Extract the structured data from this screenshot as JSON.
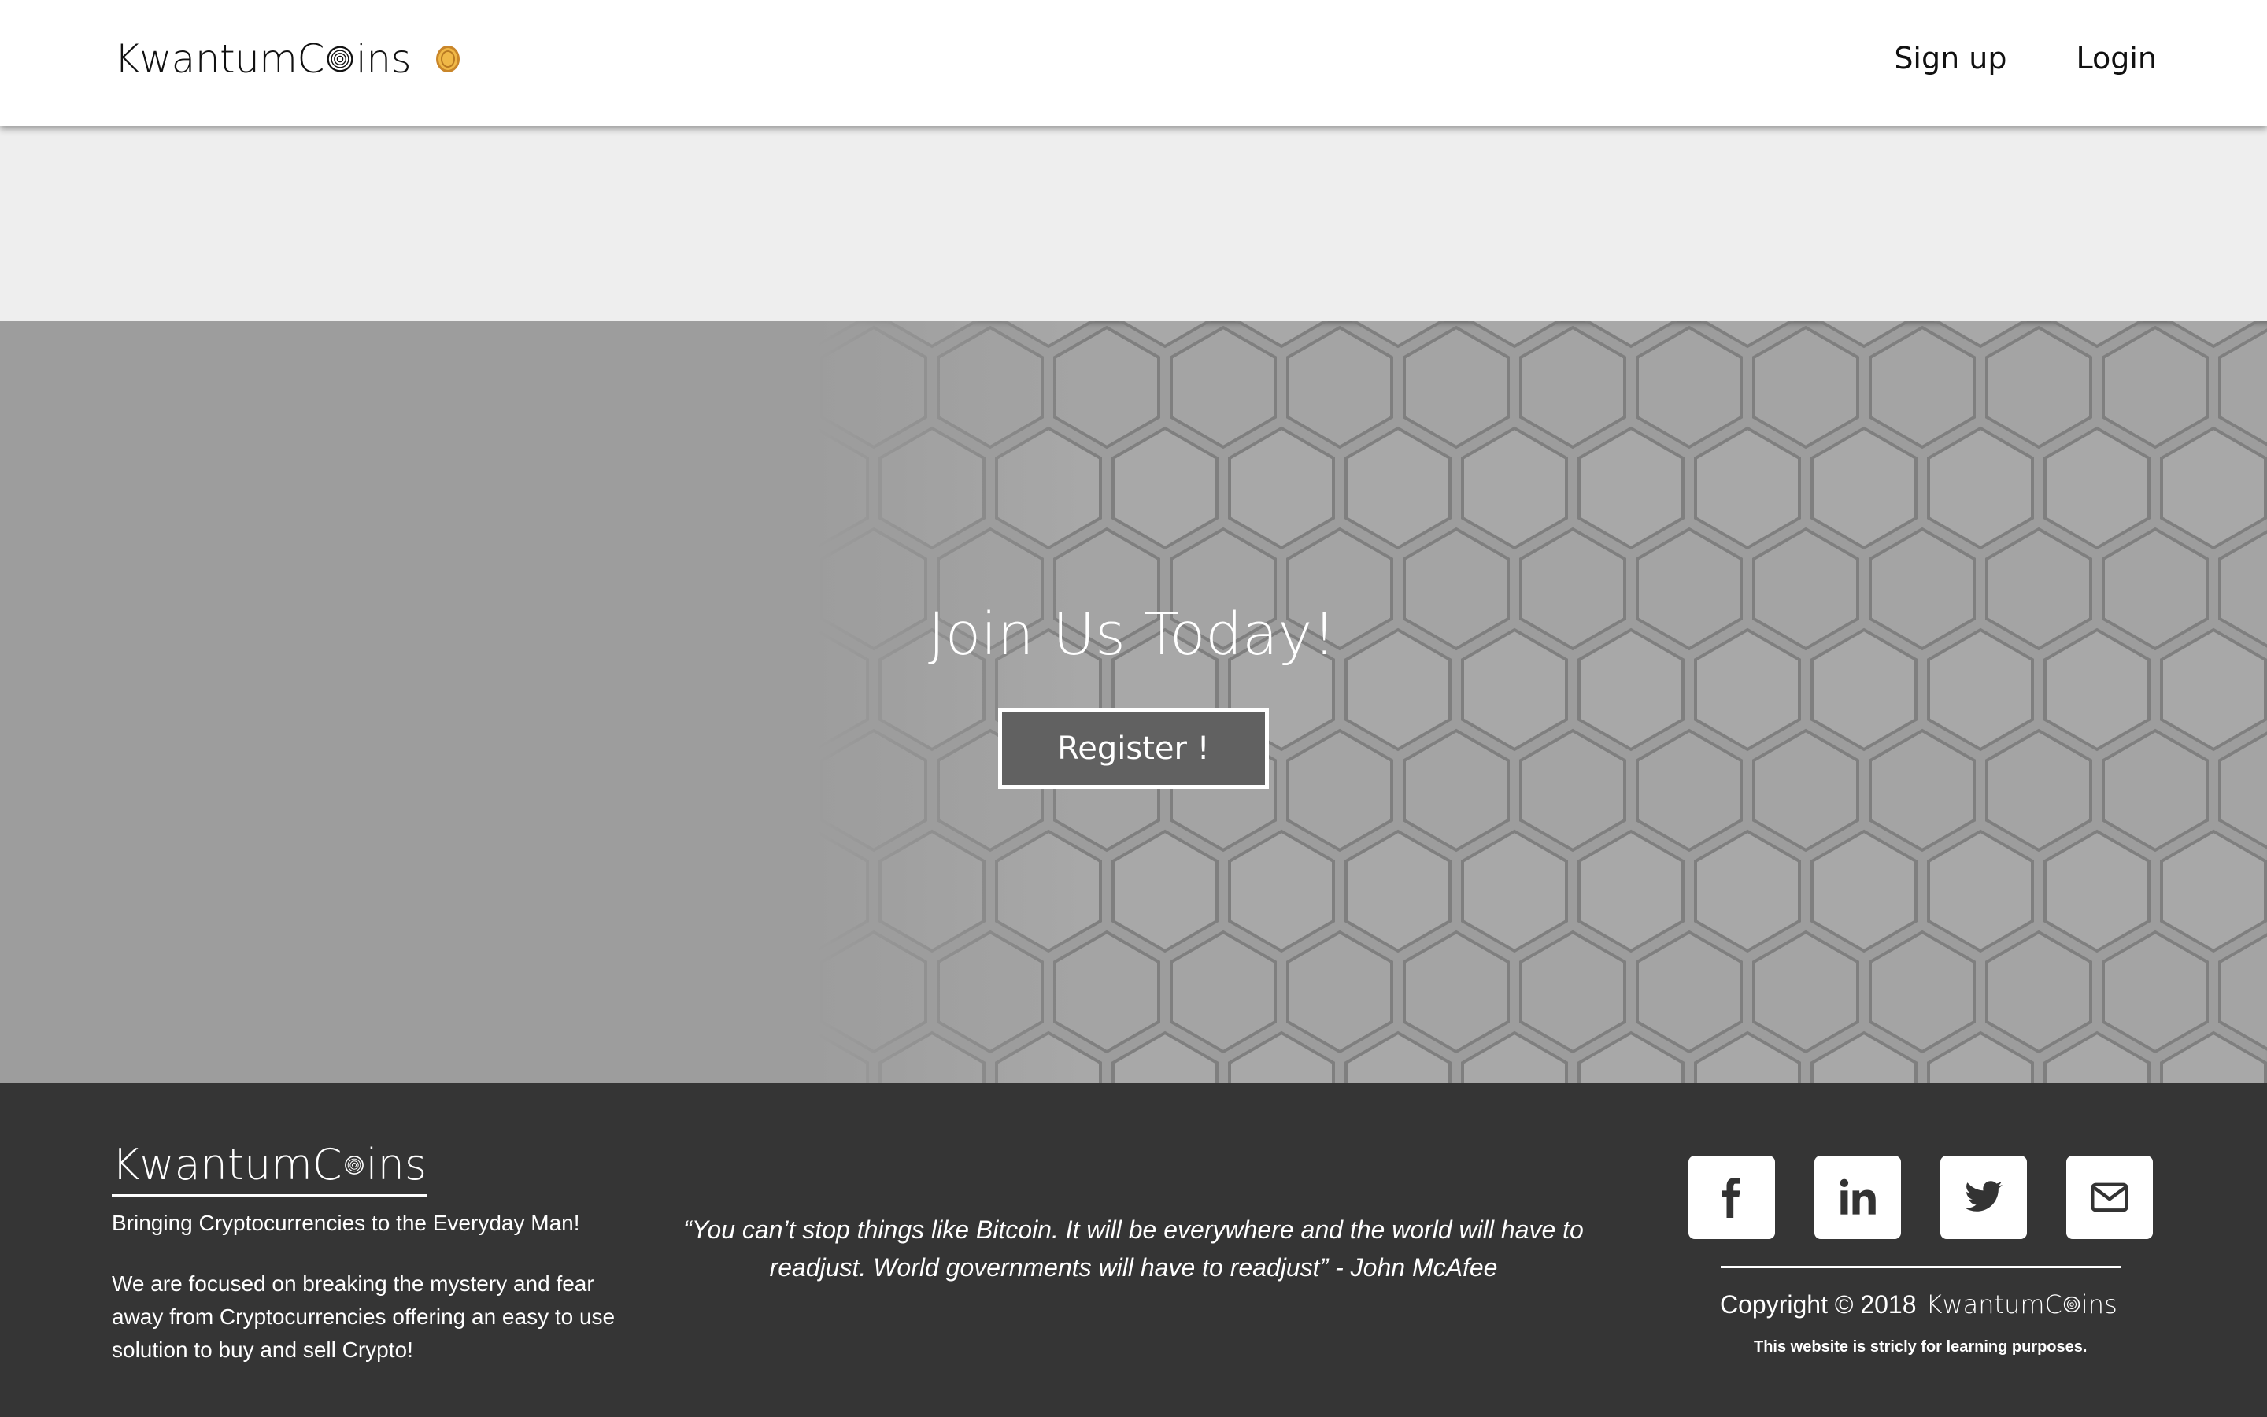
{
  "header": {
    "brand_prefix": "KwantumC",
    "brand_suffix": "ins",
    "nav": {
      "signup": "Sign up",
      "login": "Login"
    }
  },
  "hero": {
    "title": "Join Us Today!",
    "register_label": "Register !"
  },
  "footer": {
    "brand_prefix": "KwantumC",
    "brand_suffix": "ins",
    "tagline": "Bringing Cryptocurrencies to the Everyday Man!",
    "about": "We are focused on breaking the mystery and fear away from Cryptocurrencies offering an easy to use solution to buy and sell Crypto!",
    "quote": "“You can’t stop things like Bitcoin. It will be everywhere and the world will have to readjust. World governments will have to readjust” - John McAfee",
    "socials": [
      "facebook-icon",
      "linkedin-icon",
      "twitter-icon",
      "mail-icon"
    ],
    "copyright": "Copyright © 2018",
    "copyright_brand_prefix": "KwantumC",
    "copyright_brand_suffix": "ins",
    "note": "This website is stricly for learning purposes."
  },
  "colors": {
    "header_bg": "#ffffff",
    "band_bg": "#eeeeee",
    "hero_bg": "#9d9d9d",
    "button_bg": "#616161",
    "footer_bg": "#353535",
    "coin": "#e0a63a"
  }
}
